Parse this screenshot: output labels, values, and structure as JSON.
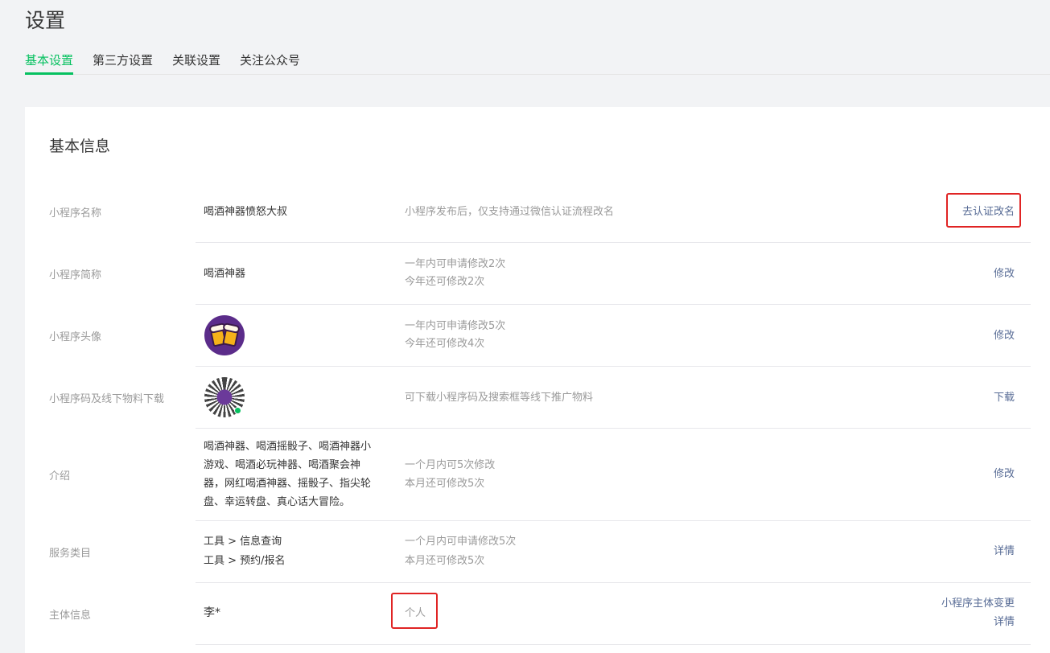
{
  "page": {
    "title": "设置"
  },
  "tabs": [
    {
      "label": "基本设置",
      "active": true
    },
    {
      "label": "第三方设置",
      "active": false
    },
    {
      "label": "关联设置",
      "active": false
    },
    {
      "label": "关注公众号",
      "active": false
    }
  ],
  "section": {
    "title": "基本信息"
  },
  "rows": {
    "name": {
      "label": "小程序名称",
      "value": "喝酒神器愤怒大叔",
      "hint": "小程序发布后，仅支持通过微信认证流程改名",
      "action": "去认证改名"
    },
    "short_name": {
      "label": "小程序简称",
      "value": "喝酒神器",
      "hint1": "一年内可申请修改2次",
      "hint2": "今年还可修改2次",
      "action": "修改"
    },
    "avatar": {
      "label": "小程序头像",
      "icon": "beer-mugs-avatar-icon",
      "hint1": "一年内可申请修改5次",
      "hint2": "今年还可修改4次",
      "action": "修改"
    },
    "qrcode": {
      "label": "小程序码及线下物料下载",
      "icon": "mini-program-code-icon",
      "hint": "可下载小程序码及搜索框等线下推广物料",
      "action": "下载"
    },
    "intro": {
      "label": "介绍",
      "lines": [
        "喝酒神器、喝酒摇骰子、喝酒神器小",
        "游戏、喝酒必玩神器、喝酒聚会神",
        "器，网红喝酒神器、摇骰子、指尖轮",
        "盘、幸运转盘、真心话大冒险。"
      ],
      "hint1": "一个月内可5次修改",
      "hint2": "本月还可修改5次",
      "action": "修改"
    },
    "category": {
      "label": "服务类目",
      "line1": "工具 > 信息查询",
      "line2": "工具 > 预约/报名",
      "hint1": "一个月内可申请修改5次",
      "hint2": "本月还可修改5次",
      "action": "详情"
    },
    "subject": {
      "label": "主体信息",
      "value": "李*",
      "hint": "个人",
      "action1": "小程序主体变更",
      "action2": "详情"
    }
  },
  "colors": {
    "accent": "#07c160",
    "link": "#576b95",
    "highlight_box": "#e02424"
  }
}
